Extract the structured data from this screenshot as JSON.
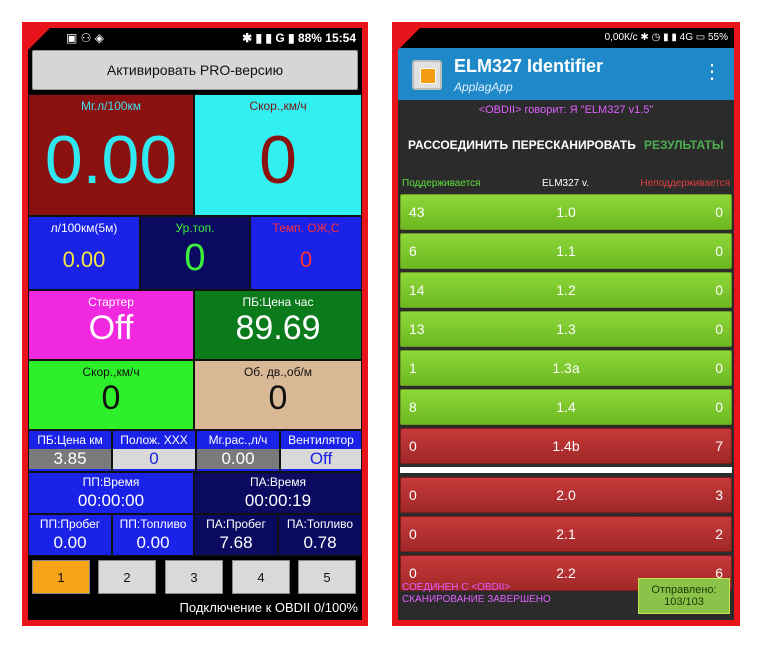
{
  "phone1": {
    "status": {
      "left_icons": "▣ ⚇ ◈",
      "right": "✱ ▮ ▮ G ▮ 88% 15:54"
    },
    "pro_button": "Активировать PRO-версию",
    "cells": [
      {
        "label": "Мг.л/100км",
        "value": "0.00"
      },
      {
        "label": "Скор.,км/ч",
        "value": "0"
      },
      {
        "label": "л/100км(5м)",
        "value": "0.00"
      },
      {
        "label": "Ур.топ.",
        "value": "0"
      },
      {
        "label": "Темп. ОЖ,С",
        "value": "0"
      },
      {
        "label": "Стартер",
        "value": "Off"
      },
      {
        "label": "ПБ:Цена час",
        "value": "89.69"
      },
      {
        "label": "Скор.,км/ч",
        "value": "0"
      },
      {
        "label": "Об. дв.,об/м",
        "value": "0"
      },
      {
        "label": "ПБ:Цена км",
        "value": "3.85"
      },
      {
        "label": "Полож. ХХХ",
        "value": "0"
      },
      {
        "label": "Мг.рас.,л/ч",
        "value": "0.00"
      },
      {
        "label": "Вентилятор",
        "value": "Off"
      },
      {
        "label": "ПП:Время",
        "value": "00:00:00"
      },
      {
        "label": "ПА:Время",
        "value": "00:00:19"
      },
      {
        "label": "ПП:Пробег",
        "value": "0.00"
      },
      {
        "label": "ПП:Топливо",
        "value": "0.00"
      },
      {
        "label": "ПА:Пробег",
        "value": "7.68"
      },
      {
        "label": "ПА:Топливо",
        "value": "0.78"
      }
    ],
    "tabs": [
      "1",
      "2",
      "3",
      "4",
      "5"
    ],
    "active_tab": "1",
    "connection": "Подключение к OBDII 0/100%"
  },
  "phone2": {
    "status": {
      "right": "0,00К/с ✱ ◷ ▮ ▮ 4G ▭ 55%"
    },
    "app_title": "ELM327 Identifier",
    "app_sub": "ApplagApp",
    "says": "<OBDII> говорит: Я \"ELM327 v1.5\"",
    "actions": {
      "disconnect": "РАССОЕДИНИТЬ",
      "rescan": "ПЕРЕСКАНИРОВАТЬ",
      "results": "РЕЗУЛЬТАТЫ"
    },
    "header": {
      "supported": "Поддерживается",
      "version": "ELM327 v.",
      "unsupported": "Неподдерживается"
    },
    "rows": [
      {
        "sup": "43",
        "ver": "1.0",
        "unsup": "0"
      },
      {
        "sup": "6",
        "ver": "1.1",
        "unsup": "0"
      },
      {
        "sup": "14",
        "ver": "1.2",
        "unsup": "0"
      },
      {
        "sup": "13",
        "ver": "1.3",
        "unsup": "0"
      },
      {
        "sup": "1",
        "ver": "1.3a",
        "unsup": "0"
      },
      {
        "sup": "8",
        "ver": "1.4",
        "unsup": "0"
      },
      {
        "sup": "0",
        "ver": "1.4b",
        "unsup": "7"
      },
      {
        "sup": "0",
        "ver": "2.0",
        "unsup": "3"
      },
      {
        "sup": "0",
        "ver": "2.1",
        "unsup": "2"
      },
      {
        "sup": "0",
        "ver": "2.2",
        "unsup": "6"
      }
    ],
    "footer": {
      "line1": "СОЕДИНЕН С <OBDII>",
      "line2": "СКАНИРОВАНИЕ ЗАВЕРШЕНО",
      "sent_label": "Отправлено:",
      "sent_value": "103/103"
    }
  }
}
